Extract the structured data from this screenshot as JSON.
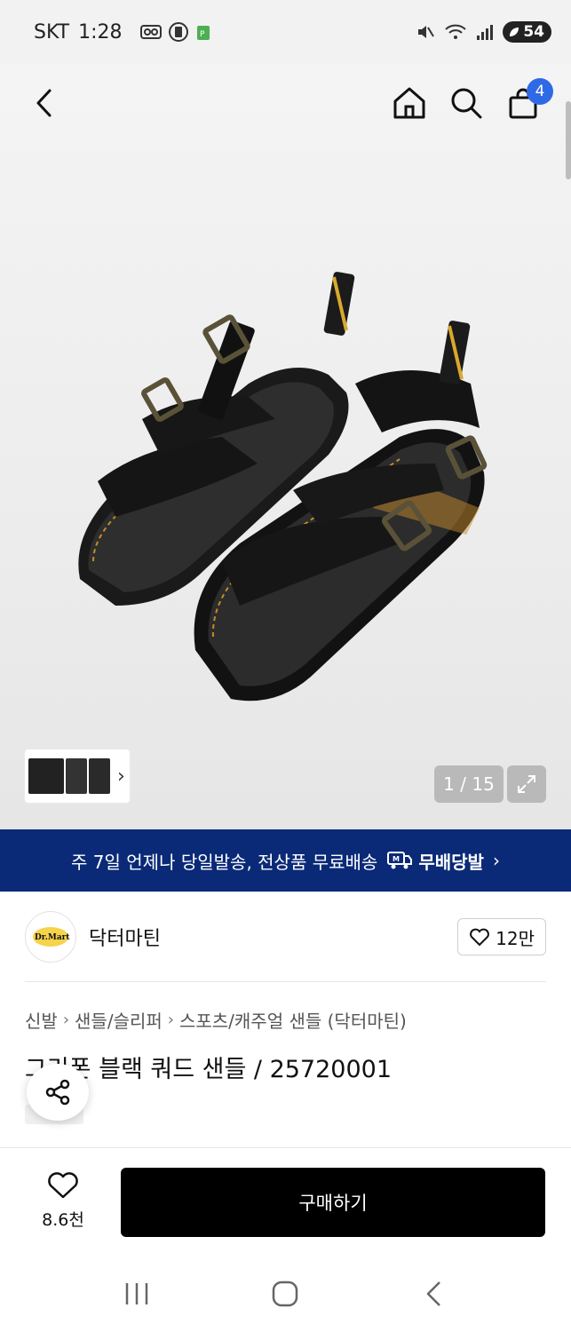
{
  "status_bar": {
    "carrier": "SKT",
    "time": "1:28",
    "battery": "54"
  },
  "nav": {
    "back_icon": "chevron-left-icon",
    "home_icon": "home-icon",
    "search_icon": "search-icon",
    "cart_icon": "shopping-bag-icon",
    "cart_count": "4"
  },
  "gallery": {
    "counter": "1 / 15",
    "thumb_arrow": "›"
  },
  "shipping_banner": {
    "text": "주 7일 언제나 당일발송, 전상품 무료배송",
    "brand": "무배당발",
    "arrow": "›"
  },
  "brand": {
    "name": "닥터마틴",
    "likes": "12만"
  },
  "breadcrumb": {
    "items": [
      "신발",
      "샌들/슬리퍼",
      "스포츠/캐주얼 샌들 (닥터마틴)"
    ]
  },
  "product": {
    "title": "그리폰 블랙 쿼드 샌들 / 25720001"
  },
  "bottom_bar": {
    "wish_count": "8.6천",
    "buy_label": "구매하기"
  },
  "colors": {
    "banner_bg": "#0a2a78",
    "badge": "#2f6ae6",
    "buy_button": "#000000"
  }
}
